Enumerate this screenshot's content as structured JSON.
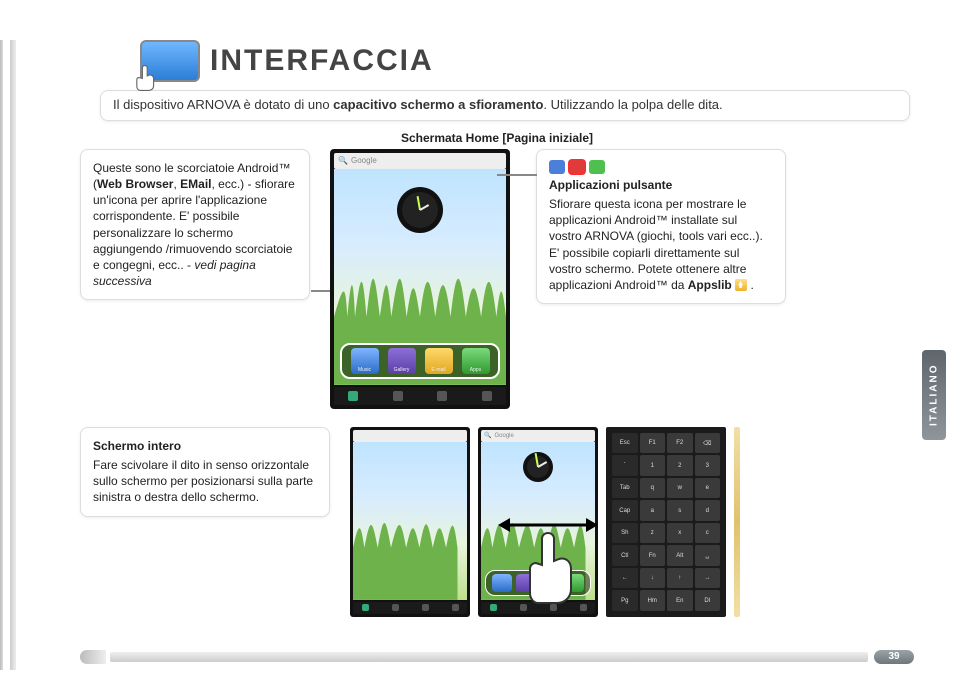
{
  "page_number": "39",
  "language_tab": "ITALIANO",
  "title": "INTERFACCIA",
  "intro": {
    "pre": "Il dispositivo ARNOVA è dotato di uno ",
    "bold": "capacitivo schermo a sfioramento",
    "post": ". Utilizzando la polpa delle dita."
  },
  "section_label": "Schermata Home [Pagina iniziale]",
  "callout_shortcuts": {
    "pre1": "Queste sono le scorciatoie Android™ (",
    "bold1": "Web Browser",
    "sep1": ", ",
    "bold2": "EMail",
    "post1": ", ecc.) - sfiorare un'icona per aprire l'applicazione corrispondente. E' possibile personalizzare lo schermo aggiungendo /rimuovendo scorciatoie e congegni, ecc.. - ",
    "em": "vedi pagina successiva"
  },
  "callout_apps": {
    "heading": "Applicazioni pulsante",
    "body_pre": "Sfiorare questa icona per mostrare le applicazioni Android™ installate sul vostro ARNOVA (giochi, tools vari ecc..). E' possibile copiarli direttamente sul vostro schermo. Potete ottenere altre applicazioni Android™ da ",
    "bold": "Appslib",
    "body_post": " ."
  },
  "callout_swipe": {
    "heading": "Schermo intero",
    "body": "Fare scivolare il dito in senso orizzontale sullo schermo per posizionarsi sulla parte sinistra o destra dello schermo."
  },
  "phone": {
    "search_label": "Google",
    "dock": [
      "Music",
      "Gallery",
      "E-mail",
      "Apps"
    ]
  },
  "keyboard_keys": [
    "Esc",
    "F1",
    "F2",
    "⌫",
    "`",
    "1",
    "2",
    "3",
    "Tab",
    "q",
    "w",
    "e",
    "Cap",
    "a",
    "s",
    "d",
    "Sh",
    "z",
    "x",
    "c",
    "Ctl",
    "Fn",
    "Alt",
    "␣",
    "←",
    "↓",
    "↑",
    "→",
    "Pg",
    "Hm",
    "En",
    "Dl"
  ]
}
